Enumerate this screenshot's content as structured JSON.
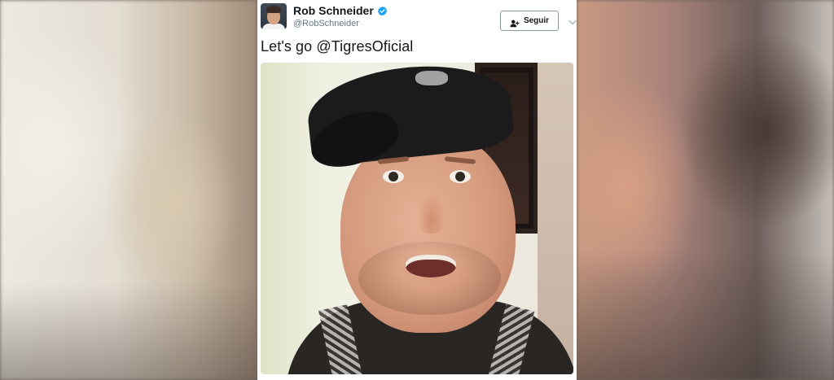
{
  "tweet": {
    "author_name": "Rob Schneider",
    "author_handle": "@RobSchneider",
    "verified": true,
    "follow_label": "Seguir",
    "text": "Let's go @TigresOficial",
    "media_type": "video"
  },
  "colors": {
    "verified_badge": "#1da1f2",
    "text_primary": "#14171a",
    "text_secondary": "#657786",
    "button_border": "#8899a6"
  },
  "icons": {
    "verified": "verified-badge-icon",
    "follow": "add-user-icon",
    "more": "chevron-down-icon"
  }
}
